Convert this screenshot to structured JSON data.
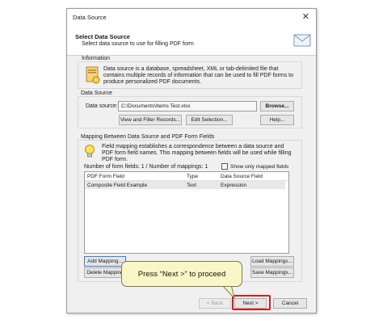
{
  "window": {
    "title": "Data Source",
    "close_glyph": "✕"
  },
  "header": {
    "title": "Select Data Source",
    "subtitle": "Select data source to use for filling PDF form"
  },
  "information": {
    "label": "Information",
    "text": "Data source is a database, spreadsheet, XML or tab-delimited file that contains multiple records of information that can be used to fill PDF forms to produce personalized PDF documents."
  },
  "data_source": {
    "label": "Data Source",
    "field_label": "Data source:",
    "value": "C:\\Documents\\Items Test.xlsx",
    "browse": "Browse...",
    "view_filter": "View and Filter Records...",
    "edit_selection": "Edit Selection...",
    "help": "Help..."
  },
  "mapping": {
    "label": "Mapping Between Data Source and PDF Form Fields",
    "text": "Field mapping establishes a correspondence between a data source and PDF form field names. This mapping between fields will be used while filling PDF form.",
    "counts": "Number of form fields: 1 / Number of mappings: 1",
    "show_only_mapped": "Show only mapped fields",
    "columns": [
      "PDF Form Field",
      "Type",
      "Data Source Field"
    ],
    "rows": [
      {
        "field": "Composite Field Example",
        "type": "Text",
        "source": "Expression"
      }
    ],
    "add": "Add Mapping...",
    "delete": "Delete Mapping",
    "load": "Load Mappings...",
    "save": "Save Mappings..."
  },
  "footer": {
    "back": "< Back",
    "next": "Next >",
    "cancel": "Cancel"
  },
  "callout": {
    "text": "Press “Next >” to proceed"
  }
}
